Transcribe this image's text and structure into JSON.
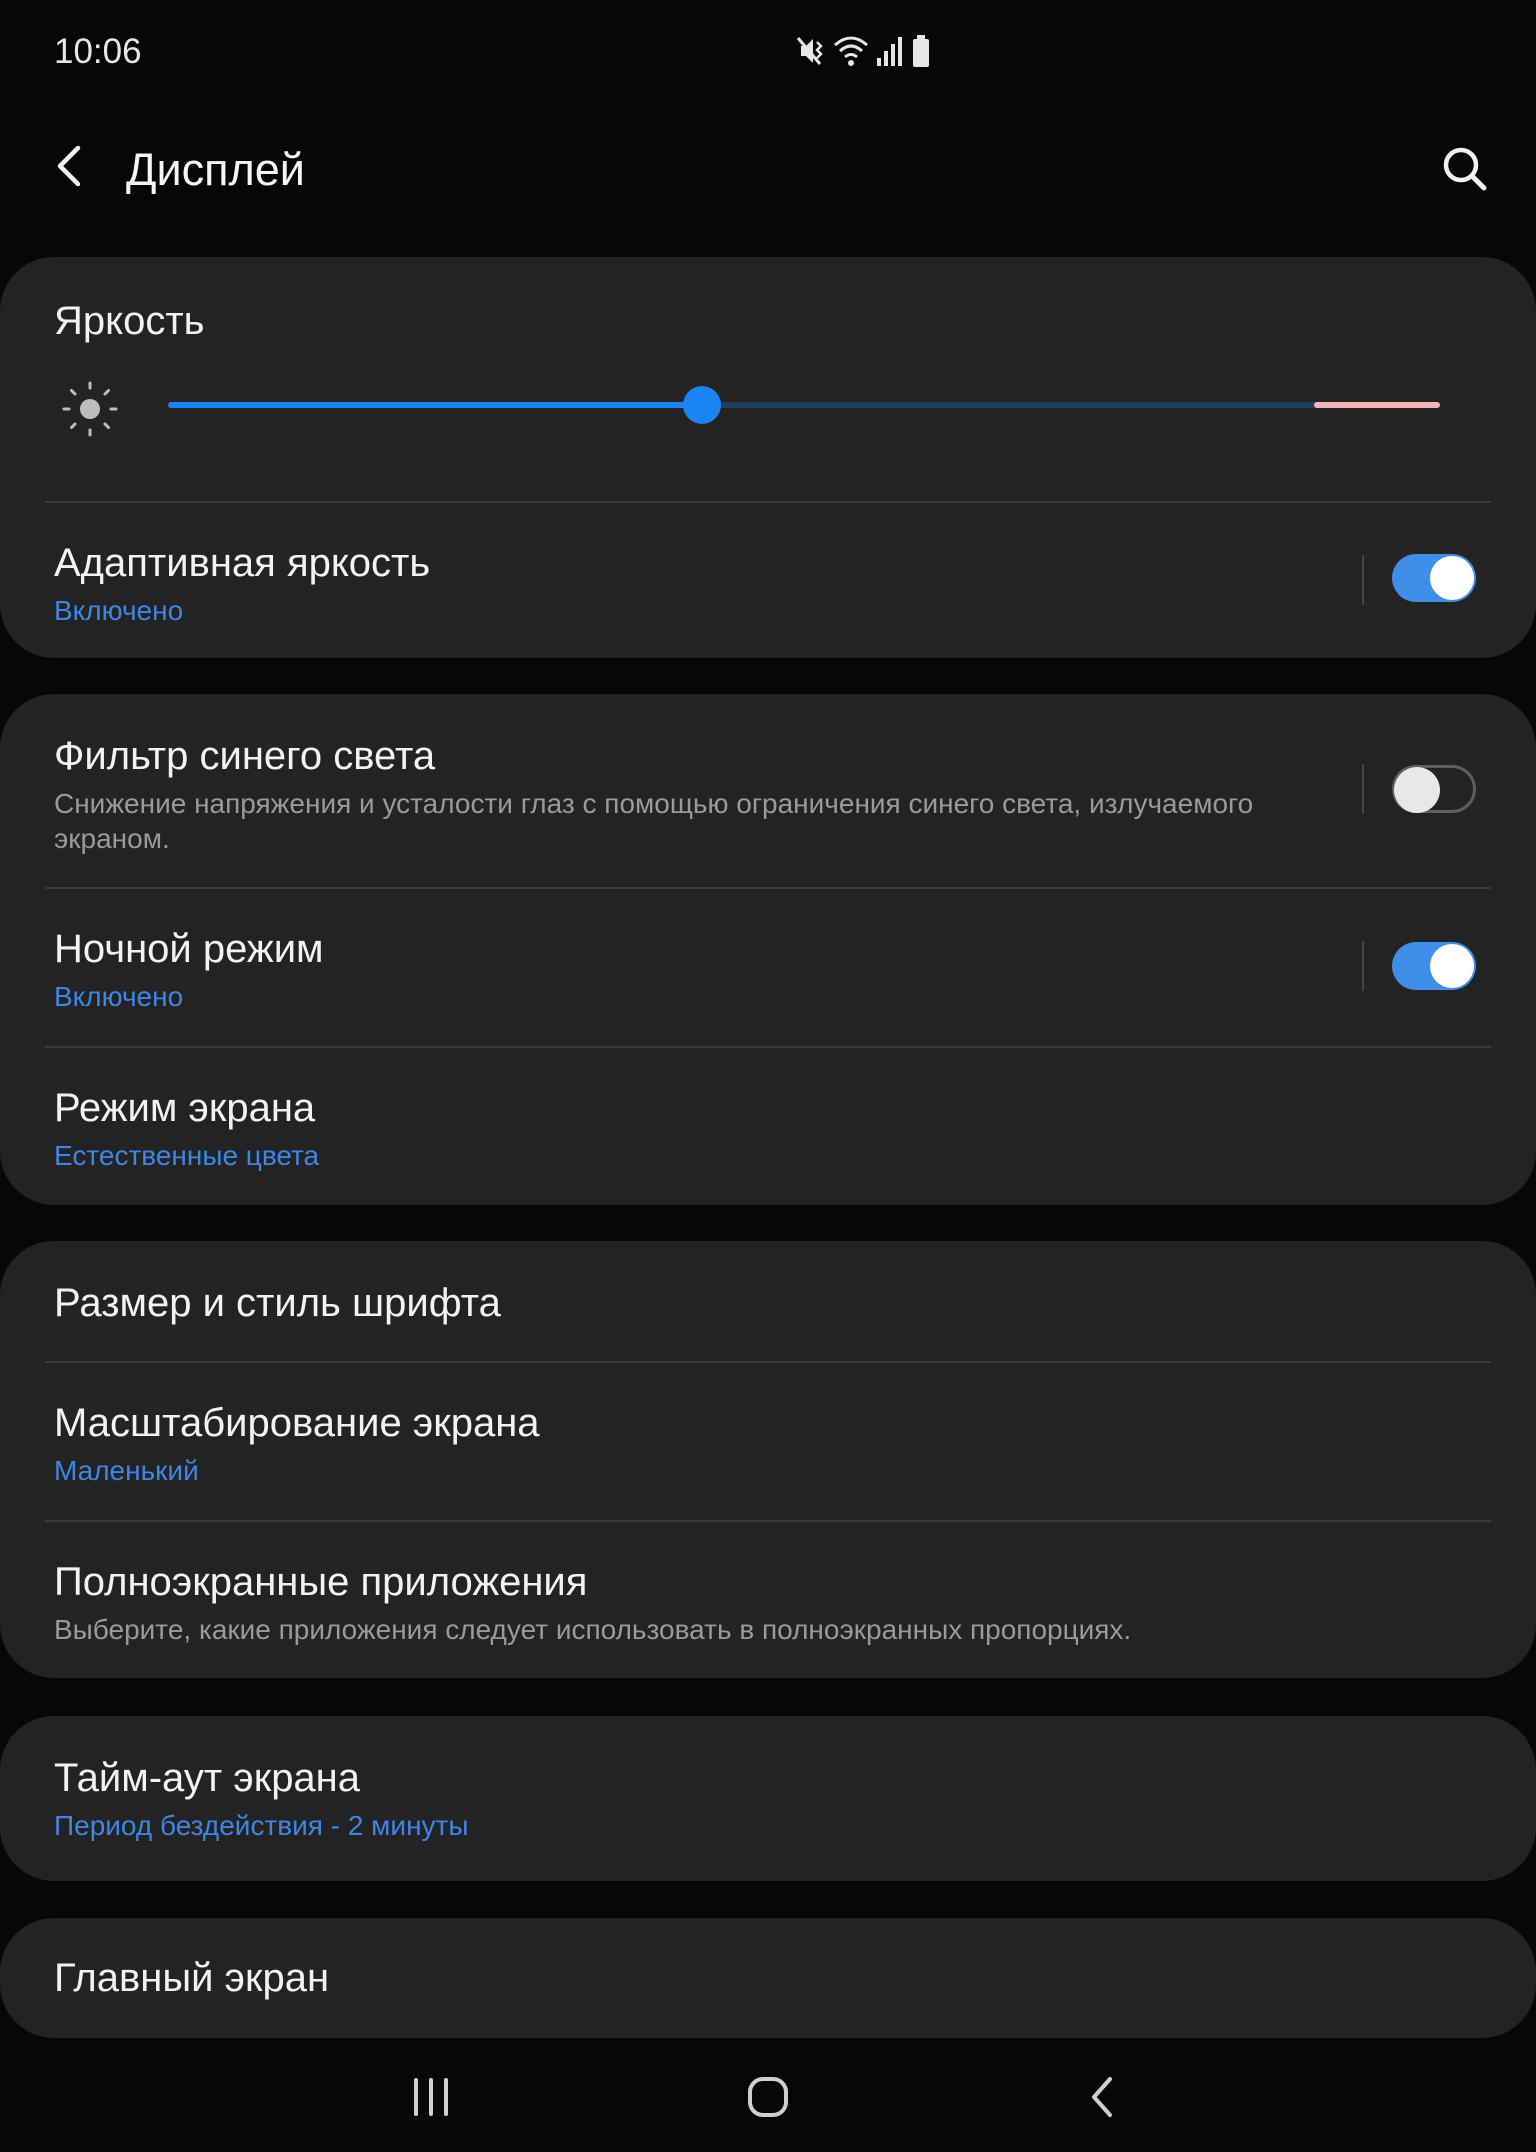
{
  "status_bar": {
    "time": "10:06",
    "icons": [
      "mute-vibrate-icon",
      "wifi-icon",
      "signal-icon",
      "battery-icon"
    ]
  },
  "app_bar": {
    "title": "Дисплей",
    "back_icon": "chevron-left-icon",
    "search_icon": "search-icon"
  },
  "brightness": {
    "label": "Яркость",
    "icon": "sun-icon",
    "level_percent": 42,
    "accent_color": "#1a84f2"
  },
  "adaptive_brightness": {
    "title": "Адаптивная яркость",
    "status": "Включено",
    "enabled": true
  },
  "blue_light_filter": {
    "title": "Фильтр синего света",
    "description": "Снижение напряжения и усталости глаз с помощью ограничения синего света, излучаемого экраном.",
    "enabled": false
  },
  "night_mode": {
    "title": "Ночной режим",
    "status": "Включено",
    "enabled": true
  },
  "screen_mode": {
    "title": "Режим экрана",
    "value": "Естественные цвета"
  },
  "font_size_style": {
    "title": "Размер и стиль шрифта"
  },
  "screen_zoom": {
    "title": "Масштабирование экрана",
    "value": "Маленький"
  },
  "fullscreen_apps": {
    "title": "Полноэкранные приложения",
    "description": "Выберите, какие приложения следует использовать в полноэкранных пропорциях."
  },
  "screen_timeout": {
    "title": "Тайм-аут экрана",
    "value": "Период бездействия - 2 минуты"
  },
  "home_screen": {
    "title": "Главный экран"
  },
  "nav_bar": {
    "recents_icon": "recents-icon",
    "home_icon": "home-icon",
    "back_icon": "back-icon"
  }
}
